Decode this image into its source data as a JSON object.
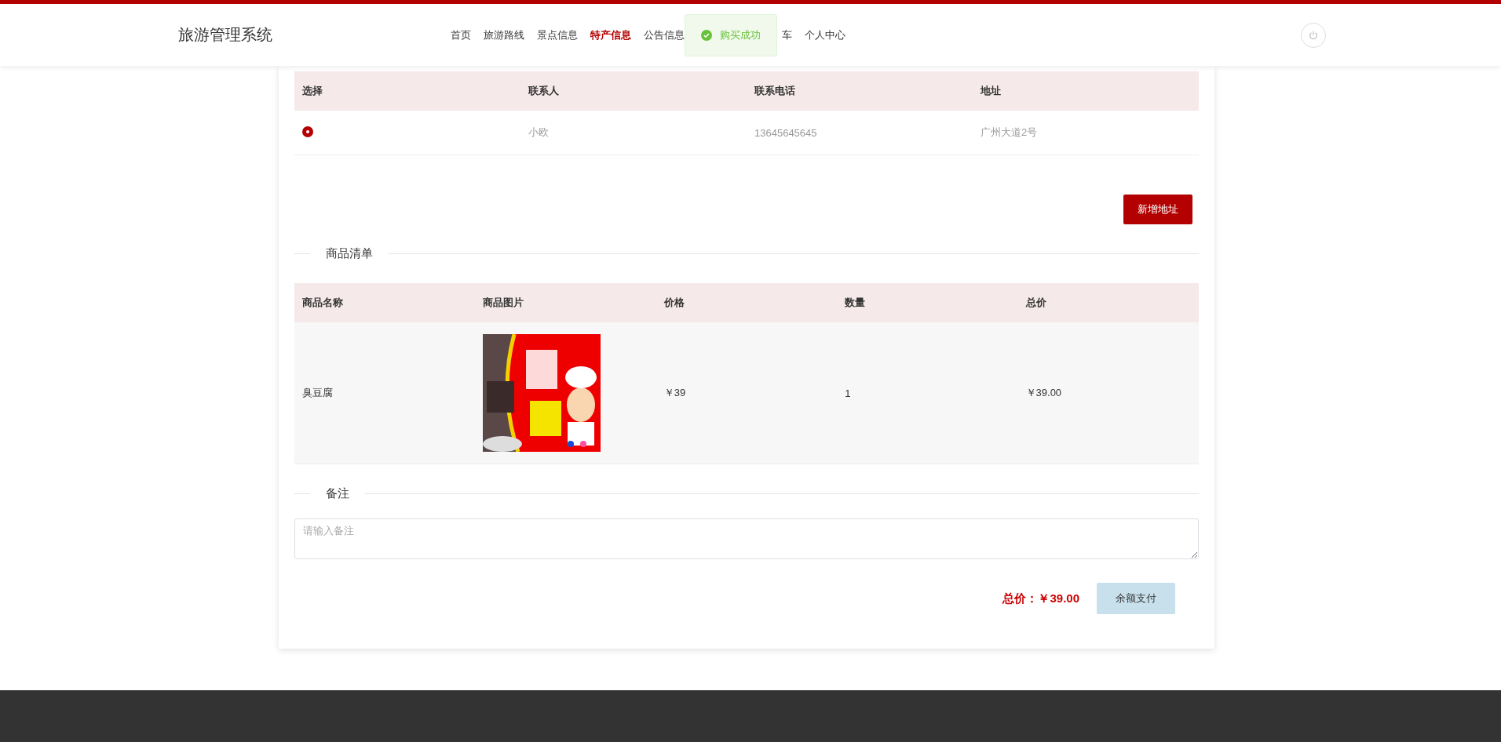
{
  "header": {
    "title": "旅游管理系统",
    "nav": [
      {
        "label": "首页",
        "selected": false
      },
      {
        "label": "旅游路线",
        "selected": false
      },
      {
        "label": "景点信息",
        "selected": false
      },
      {
        "label": "特产信息",
        "selected": true
      },
      {
        "label": "公告信息",
        "selected": false
      },
      {
        "kind": "toast",
        "label": "购买成功"
      },
      {
        "label": "车",
        "selected": false
      },
      {
        "label": "个人中心",
        "selected": false
      }
    ]
  },
  "address_table": {
    "columns": [
      "选择",
      "联系人",
      "联系电话",
      "地址"
    ],
    "rows": [
      {
        "selected": true,
        "contact": "小欧",
        "phone": "13645645645",
        "address": "广州大道2号"
      }
    ]
  },
  "add_address_button": "新增地址",
  "goods_section": {
    "title": "商品清单",
    "columns": [
      "商品名称",
      "商品图片",
      "价格",
      "数量",
      "总价"
    ],
    "rows": [
      {
        "name": "臭豆腐",
        "price": "￥39",
        "quantity": "1",
        "total": "￥39.00"
      }
    ]
  },
  "remark_section": {
    "title": "备注",
    "placeholder": "请输入备注"
  },
  "total": "总价：￥39.00",
  "pay_button": "余额支付"
}
